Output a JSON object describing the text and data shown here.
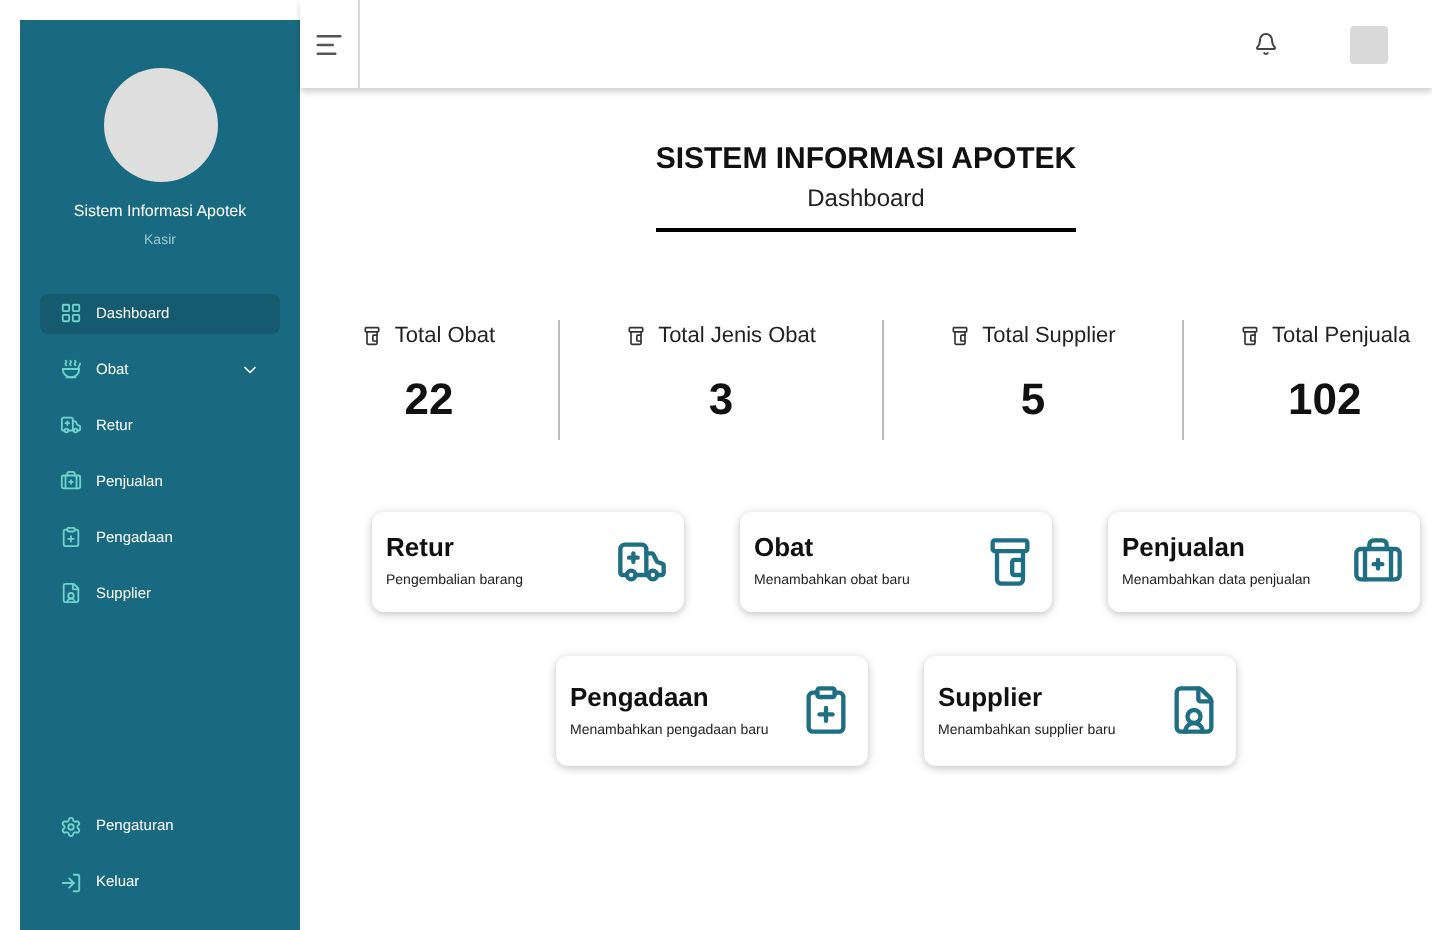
{
  "sidebar": {
    "app_name": "Sistem Informasi Apotek",
    "role": "Kasir",
    "items": [
      {
        "label": "Dashboard",
        "kind": "grid",
        "selected": true,
        "has_submenu": false
      },
      {
        "label": "Obat",
        "kind": "bowl",
        "selected": false,
        "has_submenu": true
      },
      {
        "label": "Retur",
        "kind": "truck",
        "selected": false,
        "has_submenu": false
      },
      {
        "label": "Penjualan",
        "kind": "kit",
        "selected": false,
        "has_submenu": false
      },
      {
        "label": "Pengadaan",
        "kind": "clipboard",
        "selected": false,
        "has_submenu": false
      },
      {
        "label": "Supplier",
        "kind": "fileuser",
        "selected": false,
        "has_submenu": false
      }
    ],
    "bottom_items": [
      {
        "label": "Pengaturan",
        "kind": "gear"
      },
      {
        "label": "Keluar",
        "kind": "exit"
      }
    ]
  },
  "header": {
    "title": "SISTEM INFORMASI APOTEK",
    "subtitle": "Dashboard"
  },
  "stats": [
    {
      "label": "Total Obat",
      "value": "22"
    },
    {
      "label": "Total Jenis Obat",
      "value": "3"
    },
    {
      "label": "Total Supplier",
      "value": "5"
    },
    {
      "label": "Total Penjuala",
      "value": "102"
    }
  ],
  "cards": [
    {
      "title": "Retur",
      "description": "Pengembalian barang",
      "kind": "truck"
    },
    {
      "title": "Obat",
      "description": "Menambahkan obat baru",
      "kind": "bottle"
    },
    {
      "title": "Penjualan",
      "description": "Menambahkan data penjualan",
      "kind": "kit"
    },
    {
      "title": "Pengadaan",
      "description": "Menambahkan pengadaan baru",
      "kind": "clipboard"
    },
    {
      "title": "Supplier",
      "description": "Menambahkan supplier baru",
      "kind": "fileuser"
    }
  ]
}
